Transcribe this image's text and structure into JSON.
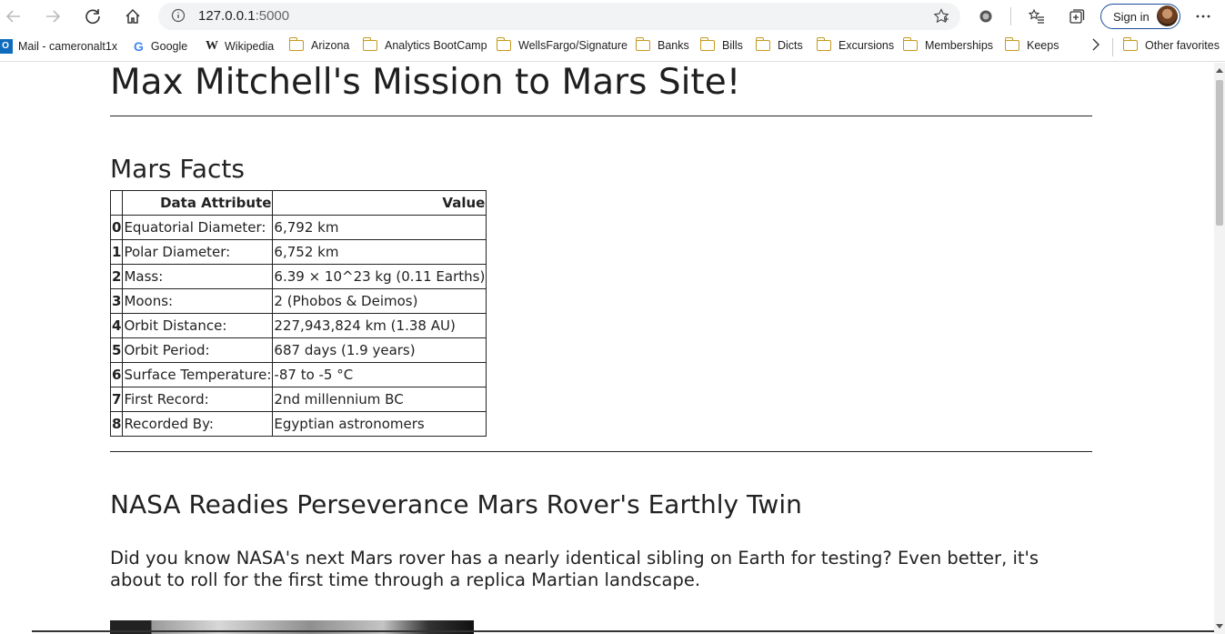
{
  "browser": {
    "url_host": "127.0.0.1",
    "url_port": ":5000",
    "sign_in_label": "Sign in"
  },
  "bookmarks": [
    {
      "label": "Mail - cameronalt1x",
      "icon": "outlook-icon"
    },
    {
      "label": "Google",
      "icon": "google-icon"
    },
    {
      "label": "Wikipedia",
      "icon": "wikipedia-icon"
    },
    {
      "label": "Arizona",
      "icon": "folder-icon"
    },
    {
      "label": "Analytics BootCamp",
      "icon": "folder-icon"
    },
    {
      "label": "WellsFargo/Signature",
      "icon": "folder-icon"
    },
    {
      "label": "Banks",
      "icon": "folder-icon"
    },
    {
      "label": "Bills",
      "icon": "folder-icon"
    },
    {
      "label": "Dicts",
      "icon": "folder-icon"
    },
    {
      "label": "Excursions",
      "icon": "folder-icon"
    },
    {
      "label": "Memberships",
      "icon": "folder-icon"
    },
    {
      "label": "Keeps",
      "icon": "folder-icon"
    }
  ],
  "other_favorites": "Other favorites",
  "page": {
    "title": "Max Mitchell's Mission to Mars Site!",
    "facts_heading": "Mars Facts",
    "table": {
      "headers": [
        "",
        "Data Attribute",
        "Value"
      ],
      "rows": [
        [
          "0",
          "Equatorial Diameter:",
          "6,792 km"
        ],
        [
          "1",
          "Polar Diameter:",
          "6,752 km"
        ],
        [
          "2",
          "Mass:",
          "6.39 × 10^23 kg (0.11 Earths)"
        ],
        [
          "3",
          "Moons:",
          "2 (Phobos & Deimos)"
        ],
        [
          "4",
          "Orbit Distance:",
          "227,943,824 km (1.38 AU)"
        ],
        [
          "5",
          "Orbit Period:",
          "687 days (1.9 years)"
        ],
        [
          "6",
          "Surface Temperature:",
          "-87 to -5 °C"
        ],
        [
          "7",
          "First Record:",
          "2nd millennium BC"
        ],
        [
          "8",
          "Recorded By:",
          "Egyptian astronomers"
        ]
      ]
    },
    "news_title": "NASA Readies Perseverance Mars Rover's Earthly Twin",
    "news_teaser": "Did you know NASA's next Mars rover has a nearly identical sibling on Earth for testing? Even better, it's about to roll for the first time through a replica Martian landscape."
  }
}
